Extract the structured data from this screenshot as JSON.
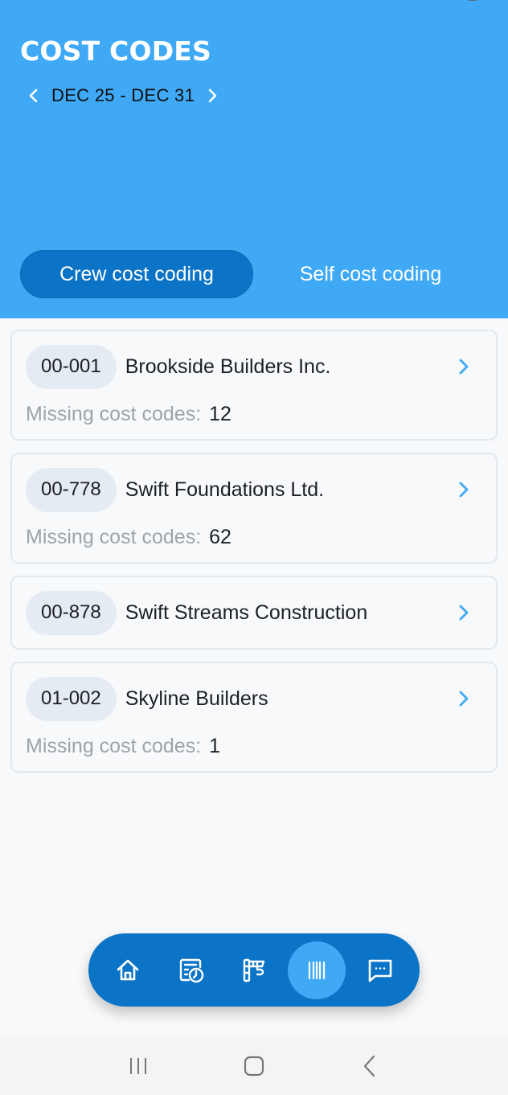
{
  "header": {
    "title": "COST CODES",
    "date_range": "DEC 25 - DEC 31",
    "prev_icon": "chevron-left-icon",
    "next_icon": "chevron-right-icon"
  },
  "tabs": [
    {
      "label": "Crew cost coding",
      "active": true
    },
    {
      "label": "Self cost coding",
      "active": false
    }
  ],
  "missing_label": "Missing cost codes:",
  "items": [
    {
      "code": "00-001",
      "name": "Brookside Builders Inc.",
      "missing": "12"
    },
    {
      "code": "00-778",
      "name": "Swift Foundations Ltd.",
      "missing": "62"
    },
    {
      "code": "00-878",
      "name": "Swift Streams Construction",
      "missing": null
    },
    {
      "code": "01-002",
      "name": "Skyline Builders",
      "missing": "1"
    }
  ],
  "bottom_nav": [
    {
      "name": "home",
      "icon": "home-icon",
      "active": false
    },
    {
      "name": "timesheets",
      "icon": "timesheet-clock-icon",
      "active": false
    },
    {
      "name": "projects",
      "icon": "crane-icon",
      "active": false
    },
    {
      "name": "cost-codes",
      "icon": "barcode-icon",
      "active": true
    },
    {
      "name": "messages",
      "icon": "chat-icon",
      "active": false
    }
  ],
  "system_nav": [
    "recents",
    "home",
    "back"
  ],
  "colors": {
    "header_bg": "#3fa9f5",
    "accent_dark": "#0c74c6",
    "chevron_blue": "#3fa9f5",
    "page_bg": "#f7f9fb",
    "chip_bg": "#e5ebf3"
  }
}
